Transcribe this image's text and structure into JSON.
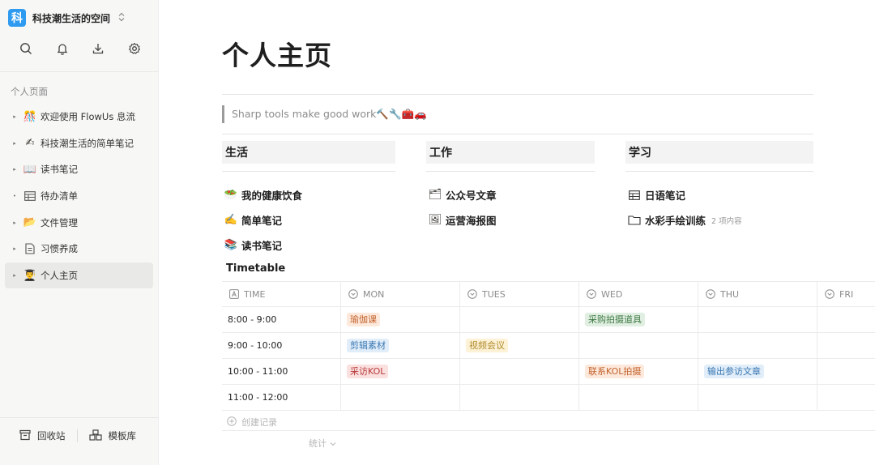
{
  "sidebar": {
    "workspace": {
      "logo_char": "科",
      "name": "科技潮生活的空间",
      "caret": "⌃"
    },
    "toolbar": [
      "search-icon",
      "bell-icon",
      "download-icon",
      "gear-icon"
    ],
    "section_title": "个人页面",
    "items": [
      {
        "label": "欢迎使用 FlowUs 息流",
        "icon": "🎊",
        "arrow": "▸",
        "active": false
      },
      {
        "label": "科技潮生活的简单笔记",
        "icon": "✍",
        "arrow": "▸",
        "active": false
      },
      {
        "label": "读书笔记",
        "icon": "📖",
        "arrow": "▸",
        "active": false
      },
      {
        "label": "待办清单",
        "icon": "table-icon",
        "arrow": "•",
        "active": false
      },
      {
        "label": "文件管理",
        "icon": "📂",
        "arrow": "▸",
        "active": false
      },
      {
        "label": "习惯养成",
        "icon": "page-icon",
        "arrow": "▸",
        "active": false
      },
      {
        "label": "个人主页",
        "icon": "👨‍🎓",
        "arrow": "▸",
        "active": true
      }
    ],
    "bottom": {
      "trash_label": "回收站",
      "templates_label": "模板库"
    }
  },
  "main": {
    "title": "个人主页",
    "quote": "Sharp tools make good work🔨🔧🧰🚗",
    "columns": [
      {
        "heading": "生活",
        "links": [
          {
            "icon": "🥗",
            "label": "我的健康饮食"
          },
          {
            "icon": "✍️",
            "label": "简单笔记"
          },
          {
            "icon": "📚",
            "label": "读书笔记"
          }
        ]
      },
      {
        "heading": "工作",
        "links": [
          {
            "icon": "🗂",
            "label": "公众号文章"
          },
          {
            "icon": "🖼",
            "label": "运营海报图"
          }
        ]
      },
      {
        "heading": "学习",
        "links": [
          {
            "icon": "table-icon",
            "label": "日语笔记"
          },
          {
            "icon": "folder-icon",
            "label": "水彩手绘训练",
            "meta": "2 项内容"
          }
        ]
      }
    ],
    "timetable": {
      "title": "Timetable",
      "headers": [
        "TIME",
        "MON",
        "TUES",
        "WED",
        "THU",
        "FRI"
      ],
      "rows": [
        {
          "time": "8:00 - 9:00",
          "mon": "瑜伽课",
          "tues": "",
          "wed": "采购拍摄道具",
          "thu": ""
        },
        {
          "time": "9:00 - 10:00",
          "mon": "剪辑素材",
          "tues": "视频会议",
          "wed": "",
          "thu": ""
        },
        {
          "time": "10:00 - 11:00",
          "mon": "采访KOL",
          "tues": "",
          "wed": "联系KOL拍摄",
          "thu": "输出参访文章"
        },
        {
          "time": "11:00 - 12:00",
          "mon": "",
          "tues": "",
          "wed": "",
          "thu": ""
        }
      ],
      "tag_colors": {
        "瑜伽课": {
          "bg": "#fde9dc",
          "fg": "#c2622b"
        },
        "剪辑素材": {
          "bg": "#e1eef9",
          "fg": "#3a77b3"
        },
        "采访KOL": {
          "bg": "#fbe0e0",
          "fg": "#b83a3a"
        },
        "视频会议": {
          "bg": "#fdf2d6",
          "fg": "#b08a2a"
        },
        "采购拍摄道具": {
          "bg": "#e1efe2",
          "fg": "#3f7a45"
        },
        "联系KOL拍摄": {
          "bg": "#fde9dc",
          "fg": "#c2622b"
        },
        "输出参访文章": {
          "bg": "#e1eef9",
          "fg": "#3a77b3"
        }
      },
      "add_label": "创建记录",
      "stats_label": "统计"
    }
  }
}
